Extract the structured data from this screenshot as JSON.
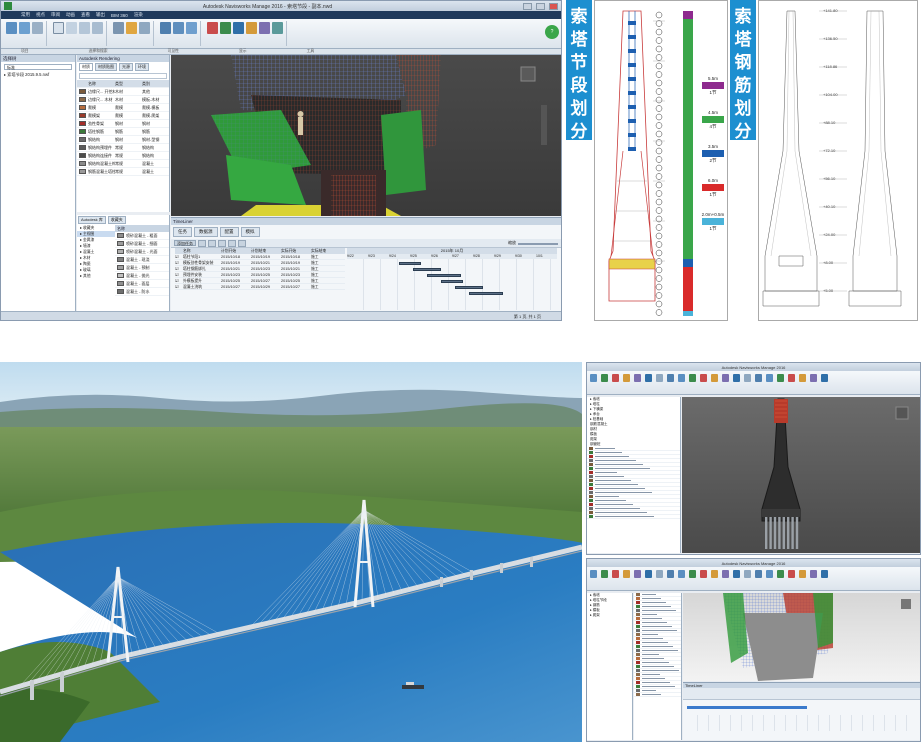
{
  "main_window": {
    "title": "Autodesk Navisworks Manage 2016 - 索塔节段 - 副本.nwd",
    "menu": [
      "常用",
      "视点",
      "审阅",
      "动画",
      "查看",
      "输出",
      "BIM 360",
      "渲染"
    ],
    "ribbon_groups": [
      "项目",
      "选择和搜索",
      "可见性",
      "显示",
      "工具"
    ],
    "ribbon_buttons": [
      "附加",
      "刷新",
      "全部重置",
      "文件选项",
      "选择",
      "保存选择",
      "全选",
      "选择相同对象",
      "选择树",
      "查找项目",
      "快速查找",
      "集合",
      "隐藏",
      "强制可见",
      "隐藏未选定对象",
      "取消隐藏所有对象",
      "链接",
      "快捷特性",
      "特性",
      "Clash Detective",
      "TimeLiner",
      "Quantification",
      "Autodesk Rendering",
      "Appearance Profiler",
      "Batch Utility",
      "比较",
      "DataTools"
    ],
    "selection_tree": {
      "header": "选择树",
      "dropdown": "标准",
      "items": [
        "索塔节段 2015.9.5.nwf"
      ]
    },
    "material_panel": {
      "header": "Autodesk Rendering",
      "tabs": [
        "材质",
        "材质贴图",
        "光源",
        "环境"
      ],
      "columns": [
        "名称",
        "类型",
        "类别"
      ],
      "rows": [
        {
          "name": "边缘尺... 开挖材",
          "type": "木材",
          "cat": "其他",
          "color": "#7a5a3a"
        },
        {
          "name": "边缘尺... 木材",
          "type": "木材",
          "cat": "模板-木材",
          "color": "#8b6a4a"
        },
        {
          "name": "爬模",
          "type": "爬模",
          "cat": "爬模-模板",
          "color": "#b56b3c"
        },
        {
          "name": "爬模架",
          "type": "爬模",
          "cat": "爬模-爬架",
          "color": "#9a3a2a"
        },
        {
          "name": "劲性骨架",
          "type": "钢材",
          "cat": "钢材",
          "color": "#a32c28"
        },
        {
          "name": "塔柱钢筋",
          "type": "钢筋",
          "cat": "钢筋",
          "color": "#3a7a3a"
        },
        {
          "name": "钢结构",
          "type": "钢材",
          "cat": "钢材-型钢",
          "color": "#6a6a6a"
        },
        {
          "name": "钢结构预埋件",
          "type": "常规",
          "cat": "钢结构",
          "color": "#5a5a5a"
        },
        {
          "name": "钢结构连接件",
          "type": "常规",
          "cat": "钢结构",
          "color": "#4a4a4a"
        },
        {
          "name": "钢结构混凝土构件",
          "type": "常规",
          "cat": "混凝土",
          "color": "#8a8a8a"
        },
        {
          "name": "钢筋混凝土塔柱",
          "type": "常规",
          "cat": "混凝土",
          "color": "#9a9a9a"
        }
      ]
    },
    "library_panel": {
      "tabs": [
        "Autodesk 库",
        "收藏夹"
      ],
      "tree": [
        "收藏夹",
        "主视图",
        "金属漆",
        "墙漆",
        "混凝土",
        "木材",
        "陶瓷",
        "玻璃",
        "其他"
      ],
      "columns": [
        "名称"
      ],
      "items": [
        "喷砂混凝土 - 粗面",
        "喷砂混凝土 - 细面",
        "喷砂混凝土 - 光面",
        "混凝土 - 现浇",
        "混凝土 - 预制",
        "混凝土 - 抛光",
        "混凝土 - 面层",
        "混凝土 - 防水"
      ]
    },
    "timeliner": {
      "header": "TimeLiner",
      "tabs": [
        "任务",
        "数据源",
        "配置",
        "模拟"
      ],
      "add_task": "添加任务",
      "zoom_label": "缩放",
      "columns": [
        "已激活",
        "名称",
        "状态",
        "计划开始",
        "计划结束",
        "实际开始",
        "实际结束"
      ],
      "timeline_header": "2015年 10月",
      "tasks": [
        {
          "name": "塔柱节段1",
          "start": "2015/10/18",
          "end": "2015/10/19",
          "type": "施工"
        },
        {
          "name": "模板劲性骨架安装",
          "start": "2015/10/19",
          "end": "2015/10/21",
          "type": "施工"
        },
        {
          "name": "塔柱钢筋绑扎",
          "start": "2015/10/21",
          "end": "2015/10/23",
          "type": "施工"
        },
        {
          "name": "预埋件安装",
          "start": "2015/10/23",
          "end": "2015/10/25",
          "type": "施工"
        },
        {
          "name": "外模板提升",
          "start": "2015/10/25",
          "end": "2015/10/27",
          "type": "施工"
        },
        {
          "name": "混凝土浇筑",
          "start": "2015/10/27",
          "end": "2015/10/29",
          "type": "施工"
        }
      ],
      "gantt_dates": [
        "9/22",
        "9/23",
        "9/24",
        "9/25",
        "9/26",
        "9/27",
        "9/28",
        "9/29",
        "9/30",
        "10/1"
      ]
    },
    "status": "第 1 页, 共 1 页"
  },
  "banner1": {
    "text": "索塔节段划分"
  },
  "banner2": {
    "text": "索塔钢筋划分"
  },
  "drawing1": {
    "legend": [
      {
        "label": "5.5m",
        "count": "1节",
        "color": "#8e2a8e"
      },
      {
        "label": "4.5m",
        "count": "4节",
        "color": "#3aa64a"
      },
      {
        "label": "3.5m",
        "count": "2节",
        "color": "#1d5fb0"
      },
      {
        "label": "6.0m",
        "count": "1节",
        "color": "#d92a2a"
      },
      {
        "label": "2.0m+0.5m",
        "count": "1节",
        "color": "#4ab3d9"
      }
    ]
  },
  "drawing2": {
    "elevations": [
      "+141.80",
      "+136.50",
      "+118.86",
      "+104.00",
      "+88.10",
      "+72.10",
      "+56.10",
      "+40.10",
      "+24.00",
      "+8.00",
      "+5.00"
    ]
  },
  "nw2": {
    "title": "Autodesk Navisworks Manage 2016",
    "tree_items": [
      "索塔",
      "塔柱",
      "下横梁",
      "承台",
      "桩基础"
    ],
    "materials": [
      "钢筋混凝土",
      "钢材",
      "模板",
      "爬架",
      "钢管桩"
    ]
  },
  "nw3": {
    "title": "Autodesk Navisworks Manage 2016",
    "tree_items": [
      "索塔",
      "塔柱节段",
      "钢筋",
      "模板",
      "爬架"
    ],
    "timeline_label": "TimeLiner"
  }
}
